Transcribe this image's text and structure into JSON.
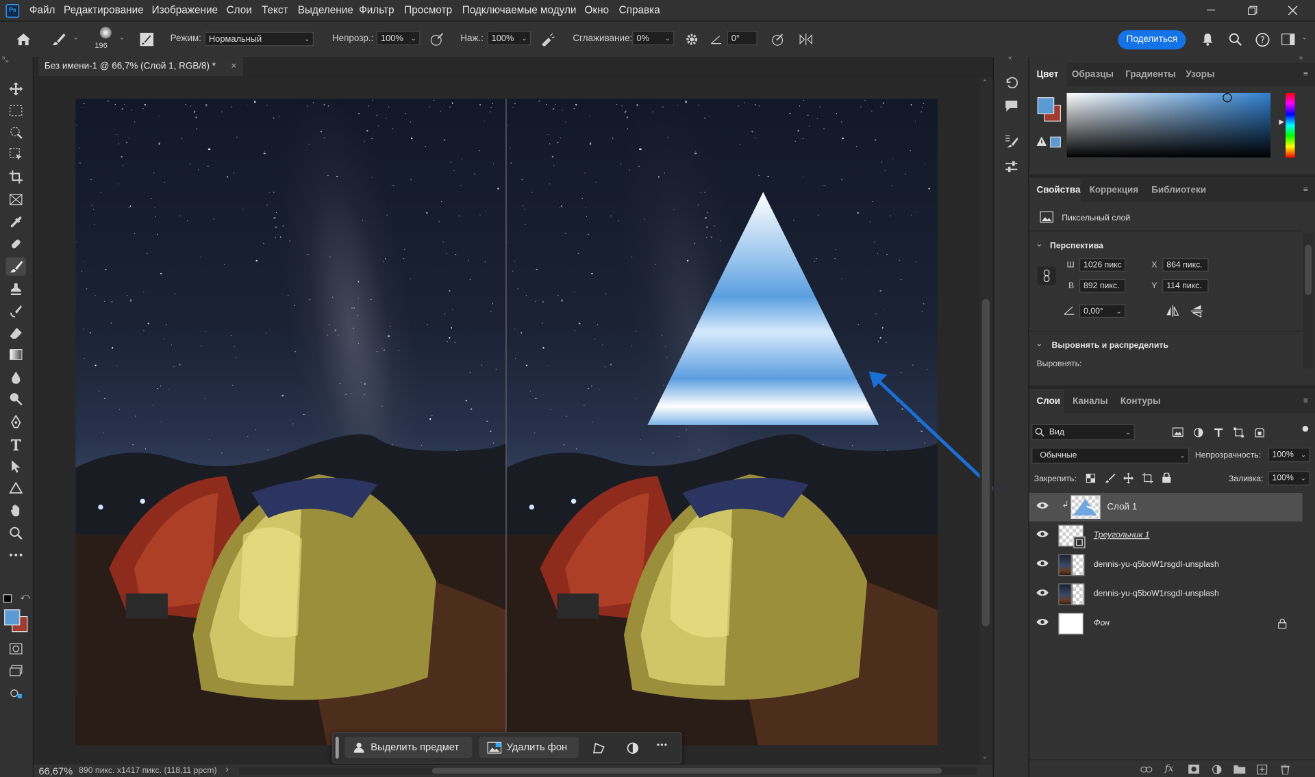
{
  "app": {
    "logo": "Ps"
  },
  "menu": [
    "Файл",
    "Редактирование",
    "Изображение",
    "Слои",
    "Текст",
    "Выделение",
    "Фильтр",
    "Просмотр",
    "Подключаемые модули",
    "Окно",
    "Справка"
  ],
  "options": {
    "brush_size": "196",
    "mode_label": "Режим:",
    "mode_value": "Нормальный",
    "opacity_label": "Непрозр.:",
    "opacity_value": "100%",
    "pressure_label": "Наж.:",
    "pressure_value": "100%",
    "smoothing_label": "Сглаживание:",
    "smoothing_value": "0%",
    "angle_value": "0°",
    "share_label": "Поделиться"
  },
  "document": {
    "tab_title": "Без имени-1 @ 66,7% (Слой 1, RGB/8) *",
    "close_glyph": "×"
  },
  "status": {
    "zoom": "66,67%",
    "info": "890 пикс. x1417 пикс. (118,11 ppcm)",
    "arrow": "›"
  },
  "taskbar": {
    "select_subject": "Выделить предмет",
    "remove_bg": "Удалить фон",
    "more": "•••"
  },
  "color_panel": {
    "tabs": [
      "Цвет",
      "Образцы",
      "Градиенты",
      "Узоры"
    ],
    "foreground": "#5b9bd5",
    "background": "#a13b2f"
  },
  "properties": {
    "tabs": [
      "Свойства",
      "Коррекция",
      "Библиотеки"
    ],
    "layer_type": "Пиксельный слой",
    "section_transform": "Перспектива",
    "w_label": "Ш",
    "w_value": "1026 пикс",
    "h_label": "В",
    "h_value": "892 пикс.",
    "x_label": "X",
    "x_value": "864 пикс.",
    "y_label": "Y",
    "y_value": "114 пикс.",
    "angle_value": "0,00°",
    "section_align": "Выровнять и распределить",
    "align_label": "Выровнять:"
  },
  "layers_panel": {
    "tabs": [
      "Слои",
      "Каналы",
      "Контуры"
    ],
    "filter_label": "Вид",
    "blend_mode": "Обычные",
    "opacity_label": "Непрозрачность:",
    "opacity_value": "100%",
    "lock_label": "Закрепить:",
    "fill_label": "Заливка:",
    "fill_value": "100%",
    "layers": [
      {
        "name": "Слой 1"
      },
      {
        "name": "Треугольник 1"
      },
      {
        "name": "dennis-yu-q5boW1rsgdI-unsplash"
      },
      {
        "name": "dennis-yu-q5boW1rsgdI-unsplash"
      },
      {
        "name": "Фон"
      }
    ]
  },
  "annotation": {
    "arrow_color": "#1a6fd6"
  }
}
